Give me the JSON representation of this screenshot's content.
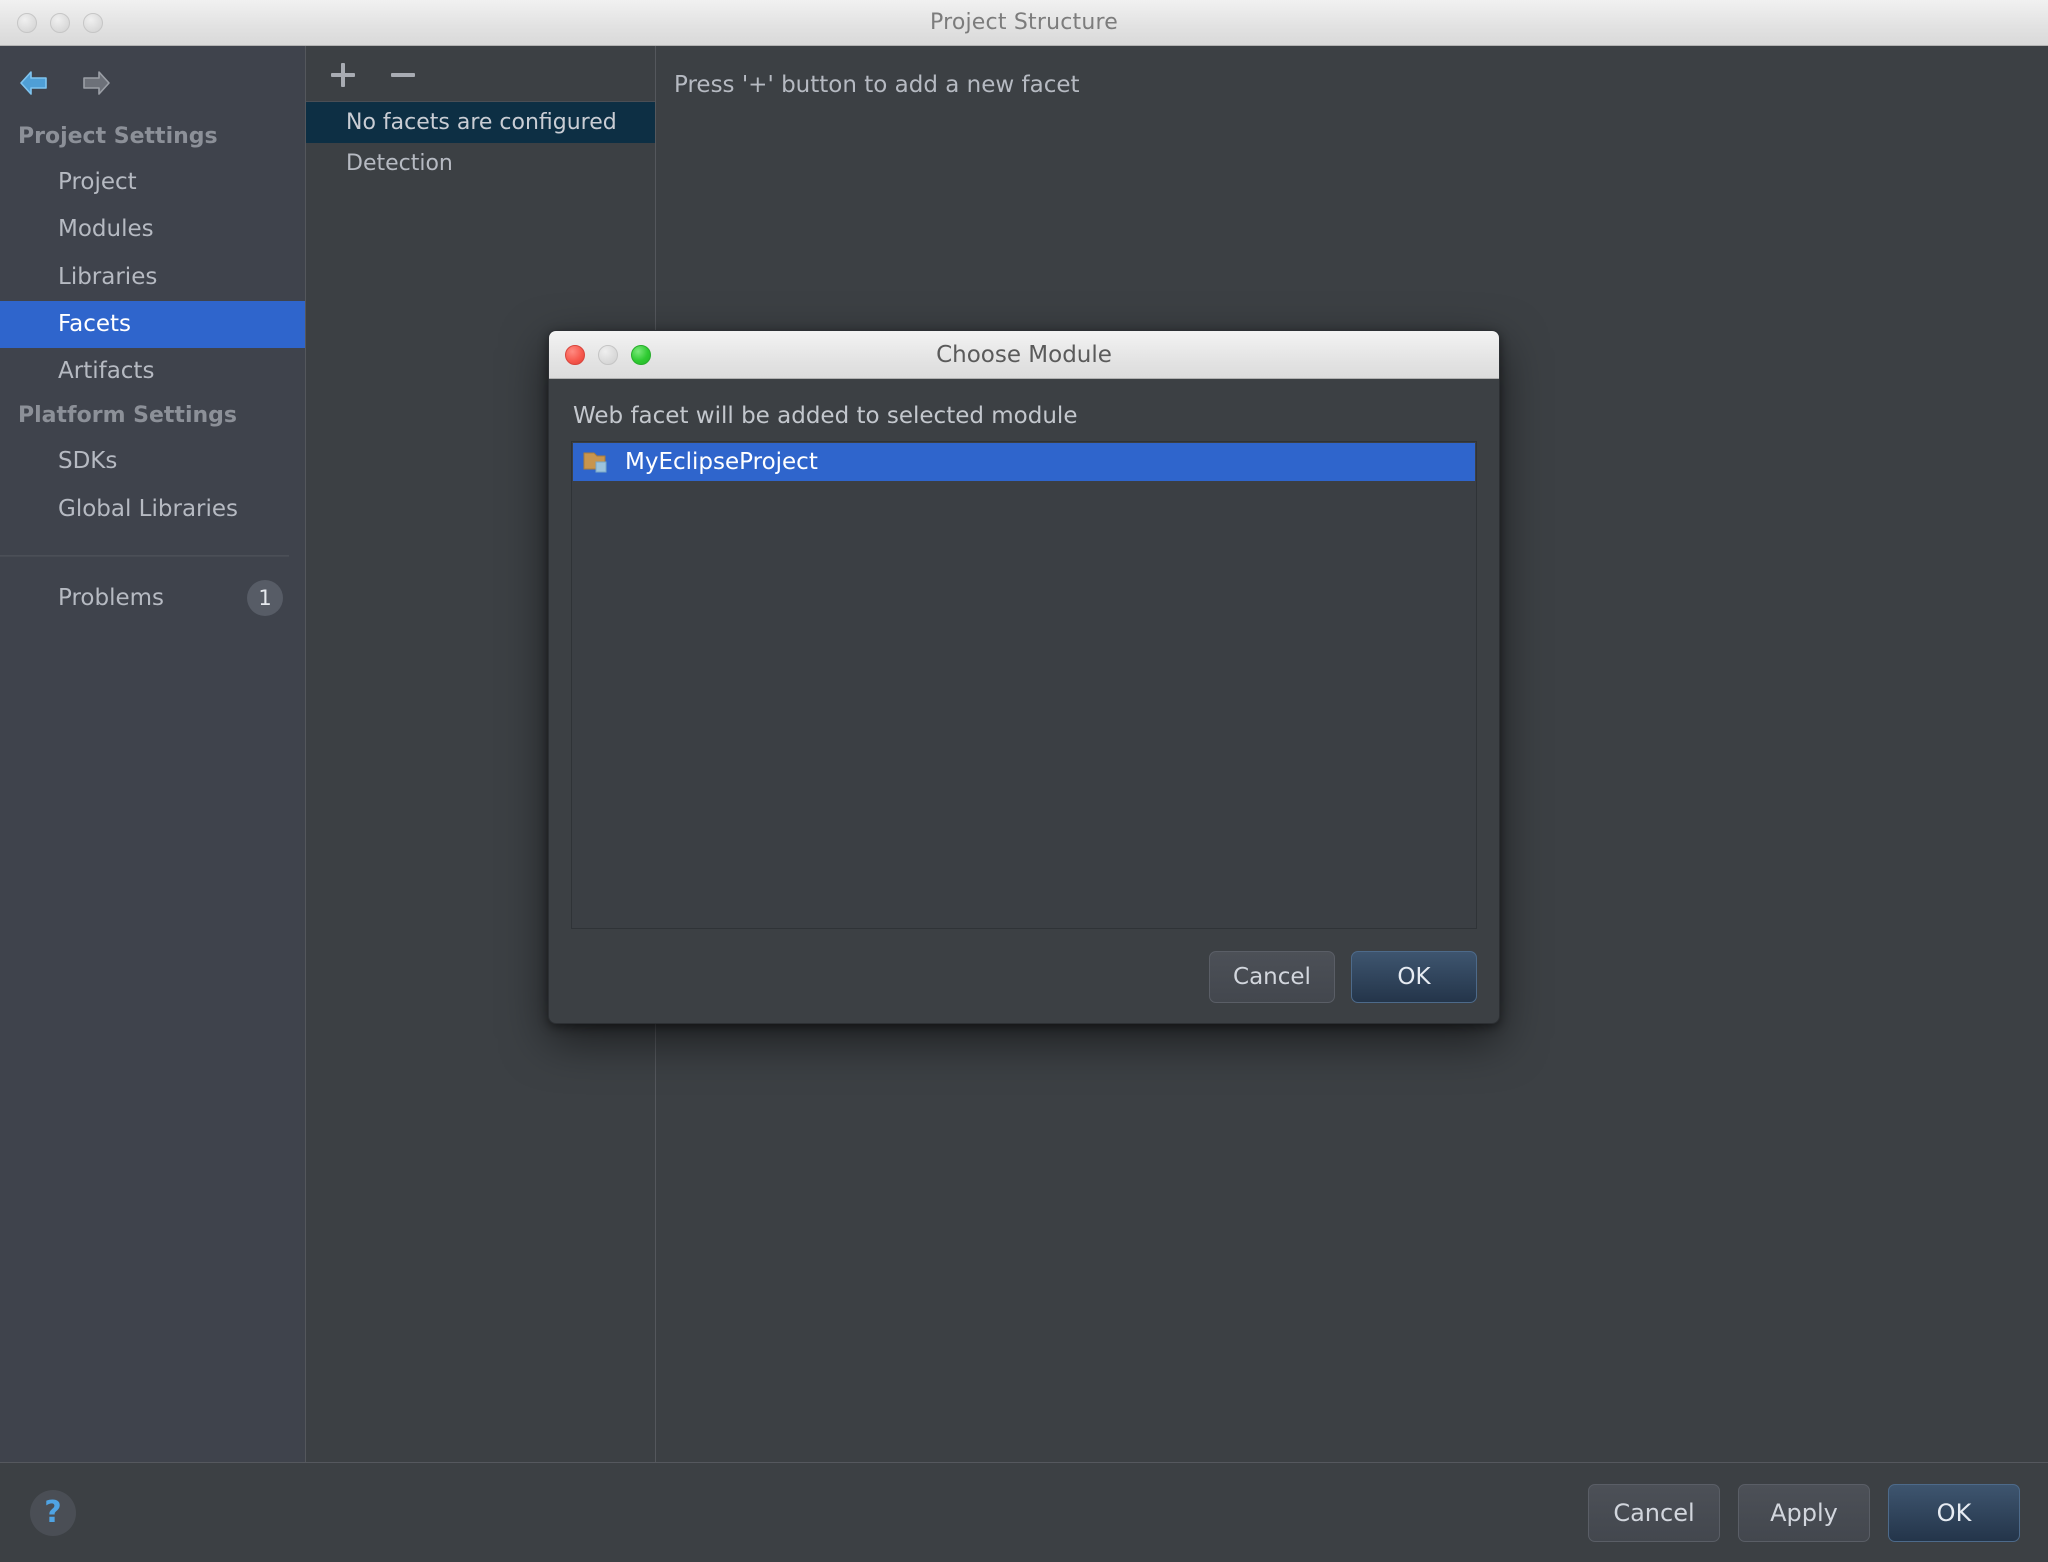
{
  "window": {
    "title": "Project Structure",
    "traffic_lights": [
      "close-inactive",
      "minimize-inactive",
      "maximize-inactive"
    ]
  },
  "sidebar": {
    "nav": {
      "back_icon": "back-arrow-icon",
      "forward_icon": "forward-arrow-icon"
    },
    "groups": [
      {
        "label": "Project Settings",
        "items": [
          {
            "label": "Project",
            "selected": false
          },
          {
            "label": "Modules",
            "selected": false
          },
          {
            "label": "Libraries",
            "selected": false
          },
          {
            "label": "Facets",
            "selected": true
          },
          {
            "label": "Artifacts",
            "selected": false
          }
        ]
      },
      {
        "label": "Platform Settings",
        "items": [
          {
            "label": "SDKs",
            "selected": false
          },
          {
            "label": "Global Libraries",
            "selected": false
          }
        ]
      }
    ],
    "problems": {
      "label": "Problems",
      "count": "1"
    }
  },
  "facet_panel": {
    "toolbar": {
      "add_label": "+",
      "remove_label": "−"
    },
    "rows": [
      {
        "label": "No facets are configured",
        "selected": true
      },
      {
        "label": "Detection",
        "selected": false
      }
    ]
  },
  "detail_panel": {
    "hint": "Press '+' button to add a new facet"
  },
  "bottom_bar": {
    "help_label": "?",
    "buttons": [
      {
        "label": "Cancel",
        "primary": false
      },
      {
        "label": "Apply",
        "primary": false
      },
      {
        "label": "OK",
        "primary": true
      }
    ]
  },
  "dialog": {
    "title": "Choose Module",
    "prompt": "Web facet will be added to selected module",
    "list": [
      {
        "label": "MyEclipseProject",
        "icon": "module-folder-icon",
        "selected": true
      }
    ],
    "buttons": [
      {
        "label": "Cancel",
        "primary": false
      },
      {
        "label": "OK",
        "primary": true
      }
    ]
  },
  "colors": {
    "accent_selection": "#2f65cc",
    "facet_row_selection": "#0d2f44",
    "window_bg": "#3c4044",
    "sidebar_bg": "#3f434c",
    "link_blue": "#4fa3e3",
    "folder_tan": "#c8954e"
  }
}
